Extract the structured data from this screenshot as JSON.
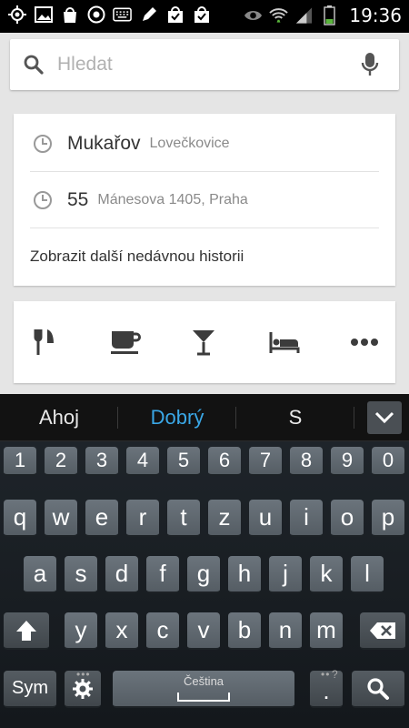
{
  "status_bar": {
    "time": "19:36",
    "left_icons": [
      "gps-icon",
      "image-icon",
      "bag-icon",
      "chrome-icon",
      "keyboard-icon",
      "pencil-icon",
      "check-bag-icon",
      "check-bag-icon"
    ],
    "right_icons": [
      "eye-icon",
      "wifi-icon",
      "signal-icon",
      "battery-icon"
    ]
  },
  "search": {
    "placeholder": "Hledat"
  },
  "history": {
    "items": [
      {
        "title": "Mukařov",
        "subtitle": "Lovečkovice"
      },
      {
        "title": "55",
        "subtitle": "Mánesova 1405, Praha"
      }
    ],
    "more_label": "Zobrazit další nedávnou historii"
  },
  "categories": {
    "items": [
      "restaurant-icon",
      "cafe-icon",
      "bar-icon",
      "hotel-icon",
      "more-icon"
    ]
  },
  "keyboard": {
    "suggestions": [
      "Ahoj",
      "Dobrý",
      "S"
    ],
    "numbers": [
      "1",
      "2",
      "3",
      "4",
      "5",
      "6",
      "7",
      "8",
      "9",
      "0"
    ],
    "row1": [
      "q",
      "w",
      "e",
      "r",
      "t",
      "z",
      "u",
      "i",
      "o",
      "p"
    ],
    "row2": [
      "a",
      "s",
      "d",
      "f",
      "g",
      "h",
      "j",
      "k",
      "l"
    ],
    "row3": [
      "y",
      "x",
      "c",
      "v",
      "b",
      "n",
      "m"
    ],
    "sym_label": "Sym",
    "space_language": "Čeština",
    "period_label": ".",
    "period_hint": "?",
    "accent_color": "#3aa7e6"
  }
}
